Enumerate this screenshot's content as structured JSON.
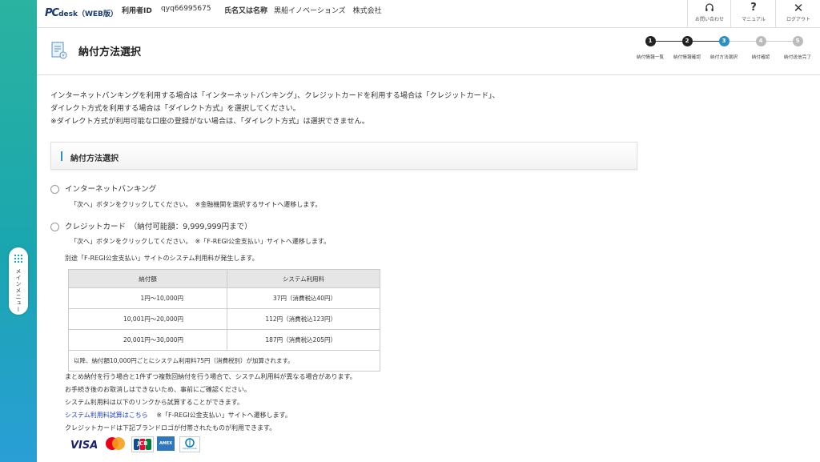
{
  "sidebar": {
    "menu_label": "メインメニュー"
  },
  "header": {
    "logo_pc": "PC",
    "logo_rest": "desk（WEB版）",
    "user_id_label": "利用者ID",
    "user_id_value": "qyq66995675",
    "name_label": "氏名又は名称",
    "name_value": "黒船イノベーションズ　株式会社",
    "buttons": [
      {
        "label": "お問い合わせ",
        "icon": "headset-icon"
      },
      {
        "label": "マニュアル",
        "icon": "question-icon"
      },
      {
        "label": "ログアウト",
        "icon": "close-icon"
      }
    ]
  },
  "page": {
    "title": "納付方法選択"
  },
  "steps": [
    {
      "num": "1",
      "label": "納付情報一覧",
      "state": "done"
    },
    {
      "num": "2",
      "label": "納付情報確認",
      "state": "done"
    },
    {
      "num": "3",
      "label": "納付方法選択",
      "state": "current"
    },
    {
      "num": "4",
      "label": "納付確認",
      "state": "todo"
    },
    {
      "num": "5",
      "label": "納付送信完了",
      "state": "todo"
    }
  ],
  "intro": [
    "インターネットバンキングを利用する場合は「インターネットバンキング」、クレジットカードを利用する場合は「クレジットカード」、",
    "ダイレクト方式を利用する場合は「ダイレクト方式」を選択してください。",
    "※ダイレクト方式が利用可能な口座の登録がない場合は、「ダイレクト方式」は選択できません。"
  ],
  "section": {
    "title": "納付方法選択"
  },
  "options": {
    "internet_banking": {
      "label": "インターネットバンキング",
      "note": "「次へ」ボタンをクリックしてください。　※金融機関を選択するサイトへ遷移します。"
    },
    "credit_card": {
      "label": "クレジットカード　（納付可能額：9,999,999円まで）",
      "note1": "「次へ」ボタンをクリックしてください。　※「F-REGI公金支払い」サイトへ遷移します。",
      "note2": "別途「F-REGI公金支払い」サイトのシステム利用料が発生します。"
    }
  },
  "fee_table": {
    "headers": [
      "納付額",
      "システム利用料"
    ],
    "rows": [
      [
        "1円～10,000円",
        "37円（消費税込40円）"
      ],
      [
        "10,001円～20,000円",
        "112円（消費税込123円）"
      ],
      [
        "20,001円～30,000円",
        "187円（消費税込205円）"
      ]
    ],
    "footer": "以降、納付額10,000円ごとにシステム利用料75円（消費税別）が加算されます。"
  },
  "tail": {
    "line1": "まとめ納付を行う場合と1件ずつ複数回納付を行う場合で、システム利用料が異なる場合があります。",
    "line2": "お手続き後のお取消しはできないため、事前にご確認ください。",
    "line3": "システム利用料は以下のリンクから試算することができます。",
    "link": "システム利用料試算はこちら",
    "link_note": "※「F-REGI公金支払い」サイトへ遷移します。",
    "line5": "クレジットカードは下記ブランドロゴが付帯されたものが利用できます。"
  },
  "brands": [
    "VISA",
    "JCB",
    "AMEX",
    "Diners Club"
  ],
  "colors": {
    "accent": "#2a8fc9",
    "step_done": "#222222",
    "step_current": "#2a8fc9",
    "step_todo": "#bbbbbb",
    "link": "#1e3fc8"
  }
}
